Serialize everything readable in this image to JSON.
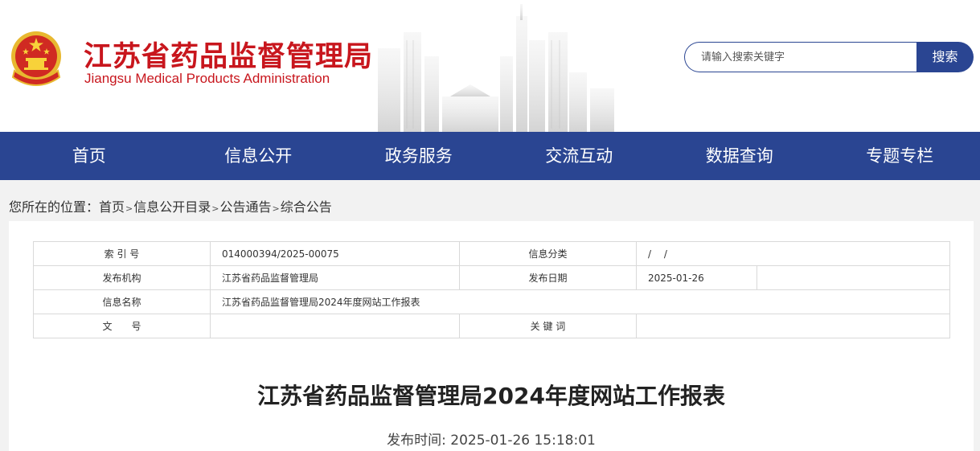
{
  "header": {
    "title_cn": "江苏省药品监督管理局",
    "title_en": "Jiangsu Medical Products Administration",
    "emblem_icon": "national-emblem-icon"
  },
  "search": {
    "placeholder": "请输入搜索关键字",
    "button_label": "搜索"
  },
  "nav": {
    "items": [
      {
        "label": "首页"
      },
      {
        "label": "信息公开"
      },
      {
        "label": "政务服务"
      },
      {
        "label": "交流互动"
      },
      {
        "label": "数据查询"
      },
      {
        "label": "专题专栏"
      }
    ]
  },
  "breadcrumb": {
    "prefix": "您所在的位置：",
    "items": [
      "首页",
      "信息公开目录",
      "公告通告",
      "综合公告"
    ],
    "separator": ">"
  },
  "meta_table": {
    "index_label": "索 引 号",
    "index_value": "014000394/2025-00075",
    "category_label": "信息分类",
    "category_value": "/　 /",
    "publisher_label": "发布机构",
    "publisher_value": "江苏省药品监督管理局",
    "date_label": "发布日期",
    "date_value": "2025-01-26",
    "name_label": "信息名称",
    "name_value": "江苏省药品监督管理局2024年度网站工作报表",
    "doc_no_label": "文　　号",
    "doc_no_value": "",
    "keywords_label": "关 键 词",
    "keywords_value": ""
  },
  "article": {
    "title": "江苏省药品监督管理局2024年度网站工作报表",
    "publish_time": "发布时间: 2025-01-26 15:18:01"
  },
  "colors": {
    "brand_red": "#c8161d",
    "nav_blue": "#2a4592",
    "gold": "#f2c230"
  }
}
